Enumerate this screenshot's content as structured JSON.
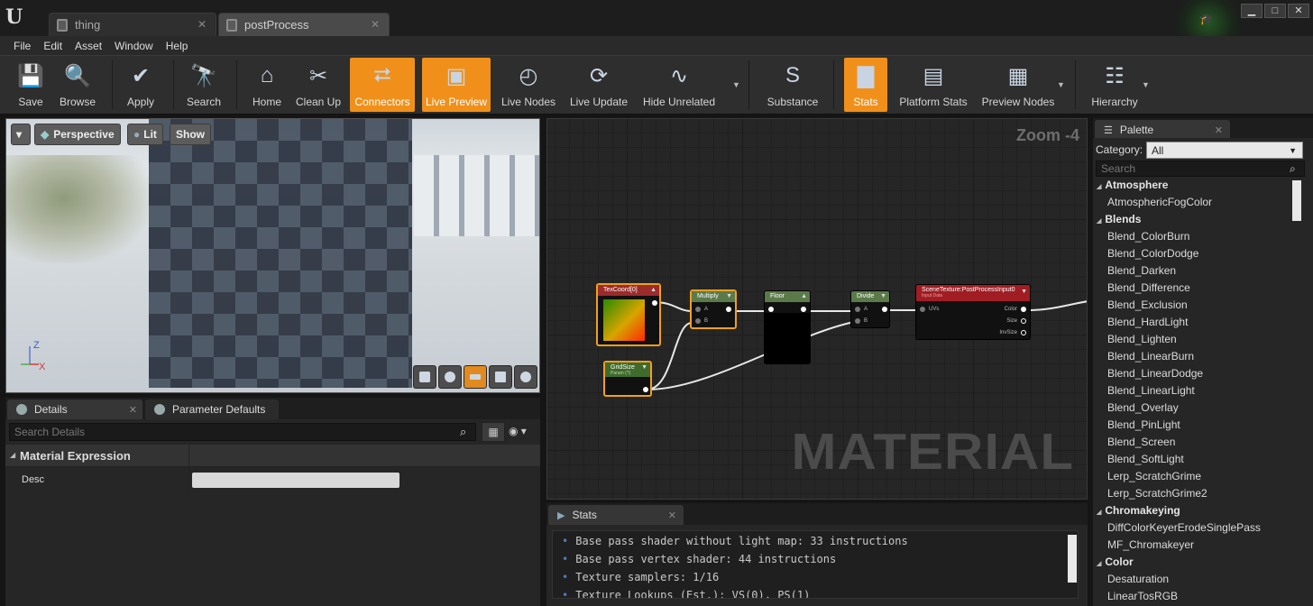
{
  "window": {
    "tabs": [
      {
        "label": "thing"
      },
      {
        "label": "postProcess"
      }
    ],
    "controls": {
      "minimize": "▁",
      "maximize": "□",
      "close": "✕"
    }
  },
  "menu": [
    "File",
    "Edit",
    "Asset",
    "Window",
    "Help"
  ],
  "toolbar": {
    "buttons": [
      {
        "label": "Save",
        "icon": "save-icon",
        "glyph": "💾",
        "active": false
      },
      {
        "label": "Browse",
        "icon": "browse-icon",
        "glyph": "🔍",
        "active": false
      },
      {
        "label": "Apply",
        "icon": "apply-icon",
        "glyph": "✔",
        "active": false
      },
      {
        "label": "Search",
        "icon": "search-icon",
        "glyph": "🔭",
        "active": false
      },
      {
        "label": "Home",
        "icon": "home-icon",
        "glyph": "⌂",
        "active": false
      },
      {
        "label": "Clean Up",
        "icon": "cleanup-icon",
        "glyph": "✂",
        "active": false
      },
      {
        "label": "Connectors",
        "icon": "connectors-icon",
        "glyph": "⮂",
        "active": true
      },
      {
        "label": "Live Preview",
        "icon": "live-preview-icon",
        "glyph": "▣",
        "active": true
      },
      {
        "label": "Live Nodes",
        "icon": "live-nodes-icon",
        "glyph": "◴",
        "active": false
      },
      {
        "label": "Live Update",
        "icon": "live-update-icon",
        "glyph": "⟳",
        "active": false
      },
      {
        "label": "Hide Unrelated",
        "icon": "hide-unrelated-icon",
        "glyph": "∿",
        "active": false
      },
      {
        "label": "Substance",
        "icon": "substance-icon",
        "glyph": "S",
        "active": false
      },
      {
        "label": "Stats",
        "icon": "stats-icon",
        "glyph": "▇",
        "active": true
      },
      {
        "label": "Platform Stats",
        "icon": "platform-stats-icon",
        "glyph": "▤",
        "active": false
      },
      {
        "label": "Preview Nodes",
        "icon": "preview-nodes-icon",
        "glyph": "▦",
        "active": false
      },
      {
        "label": "Hierarchy",
        "icon": "hierarchy-icon",
        "glyph": "☷",
        "active": false
      }
    ]
  },
  "viewport": {
    "view_mode": "Perspective",
    "lighting": "Lit",
    "show": "Show",
    "axis": {
      "z": "Z",
      "x": "X"
    }
  },
  "details": {
    "tabs": [
      {
        "label": "Details"
      },
      {
        "label": "Parameter Defaults"
      }
    ],
    "search_placeholder": "Search Details",
    "section": "Material Expression",
    "desc_label": "Desc",
    "desc_value": ""
  },
  "graph": {
    "zoom": "Zoom -4",
    "watermark": "MATERIAL",
    "nodes": {
      "texcoord": {
        "title": "TexCoord[0]"
      },
      "gridsize": {
        "title": "GridSize",
        "subtitle": "Param (?)"
      },
      "multiply": {
        "title": "Multiply",
        "pins": [
          "A",
          "B"
        ]
      },
      "floor": {
        "title": "Floor"
      },
      "divide": {
        "title": "Divide",
        "pins": [
          "A",
          "B"
        ]
      },
      "scenetexture": {
        "title": "SceneTexture:PostProcessInput0",
        "subtitle": "Input Data",
        "in_pin": "UVs",
        "out_pins": [
          "Color",
          "Size",
          "InvSize"
        ]
      }
    },
    "colors": {
      "selected_border": "#f0a020",
      "node_texcoord": "#9c2b2b",
      "node_math": "#5b7a4a",
      "node_scene": "#a01d24"
    }
  },
  "stats": {
    "tab": "Stats",
    "lines": [
      "Base pass shader without light map: 33 instructions",
      "Base pass vertex shader: 44 instructions",
      "Texture samplers: 1/16",
      "Texture Lookups (Est.): VS(0), PS(1)"
    ]
  },
  "palette": {
    "tab": "Palette",
    "category_label": "Category:",
    "category_value": "All",
    "search_placeholder": "Search",
    "entries": [
      {
        "type": "cat",
        "label": "Atmosphere"
      },
      {
        "type": "item",
        "label": "AtmosphericFogColor"
      },
      {
        "type": "cat",
        "label": "Blends"
      },
      {
        "type": "item",
        "label": "Blend_ColorBurn"
      },
      {
        "type": "item",
        "label": "Blend_ColorDodge"
      },
      {
        "type": "item",
        "label": "Blend_Darken"
      },
      {
        "type": "item",
        "label": "Blend_Difference"
      },
      {
        "type": "item",
        "label": "Blend_Exclusion"
      },
      {
        "type": "item",
        "label": "Blend_HardLight"
      },
      {
        "type": "item",
        "label": "Blend_Lighten"
      },
      {
        "type": "item",
        "label": "Blend_LinearBurn"
      },
      {
        "type": "item",
        "label": "Blend_LinearDodge"
      },
      {
        "type": "item",
        "label": "Blend_LinearLight"
      },
      {
        "type": "item",
        "label": "Blend_Overlay"
      },
      {
        "type": "item",
        "label": "Blend_PinLight"
      },
      {
        "type": "item",
        "label": "Blend_Screen"
      },
      {
        "type": "item",
        "label": "Blend_SoftLight"
      },
      {
        "type": "item",
        "label": "Lerp_ScratchGrime"
      },
      {
        "type": "item",
        "label": "Lerp_ScratchGrime2"
      },
      {
        "type": "cat",
        "label": "Chromakeying"
      },
      {
        "type": "item",
        "label": "DiffColorKeyerErodeSinglePass"
      },
      {
        "type": "item",
        "label": "MF_Chromakeyer"
      },
      {
        "type": "cat",
        "label": "Color"
      },
      {
        "type": "item",
        "label": "Desaturation"
      },
      {
        "type": "item",
        "label": "LinearTosRGB"
      }
    ]
  }
}
